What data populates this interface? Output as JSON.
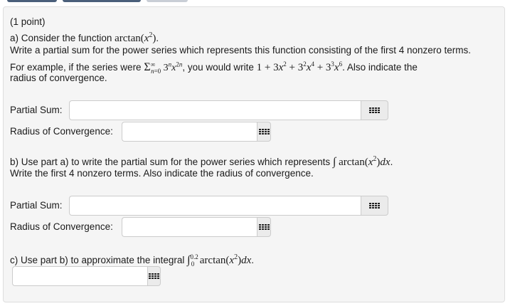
{
  "problem": {
    "points": "(1 point)",
    "part_a": {
      "intro": "a) Consider the function ",
      "function": "arctan(x²)",
      "intro_end": ".",
      "instruction": "Write a partial sum for the power series which represents this function consisting of the first 4 nonzero terms.",
      "example_prefix": "For example, if the series were ",
      "example_series": "Σ∞n=0 3ⁿ x²ⁿ",
      "example_mid": ", you would write ",
      "example_answer": "1 + 3x² + 3²x⁴ + 3³x⁶",
      "example_suffix": ". Also indicate the",
      "example_line2": "radius of convergence.",
      "partial_sum_label": "Partial Sum:",
      "radius_label": "Radius of Convergence:"
    },
    "part_b": {
      "prefix": "b) Use part a) to write the partial sum for the power series which represents ",
      "integral": "∫ arctan(x²)dx",
      "suffix": ".",
      "line2": "Write the first 4 nonzero terms. Also indicate the radius of convergence.",
      "partial_sum_label": "Partial Sum:",
      "radius_label": "Radius of Convergence:"
    },
    "part_c": {
      "prefix": "c) Use part b) to approximate the integral ",
      "integral": "∫₀^0.2 arctan(x²)dx",
      "suffix": "."
    }
  },
  "icons": {
    "answer_button": "equation-editor-grid-icon"
  },
  "colors": {
    "panel_bg": "#f5f5f5",
    "input_border": "#cccccc",
    "button_bg": "#ebebeb",
    "top_tab": "#4a5f7a"
  }
}
